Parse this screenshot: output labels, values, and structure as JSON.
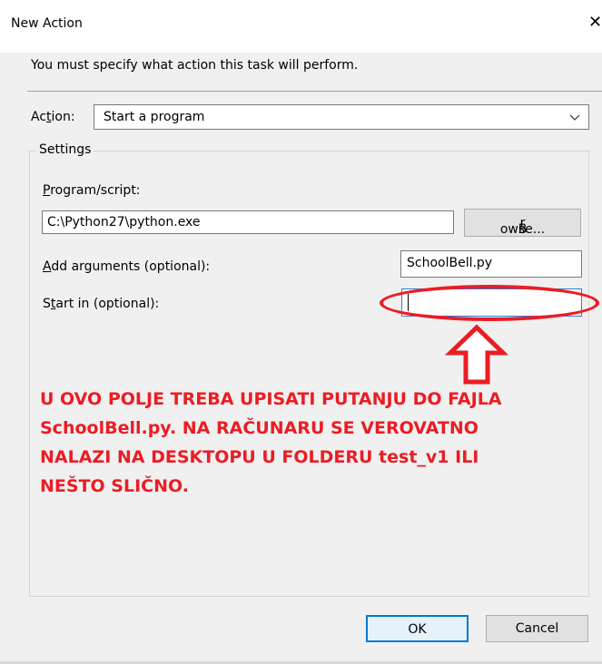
{
  "window": {
    "title": "New Action",
    "close_glyph": "✕"
  },
  "instruction": "You must specify what action this task will perform.",
  "action": {
    "label_pre": "Ac",
    "label_accel": "t",
    "label_post": "ion:",
    "value": "Start a program"
  },
  "settings": {
    "title": "Settings",
    "program": {
      "label_accel": "P",
      "label_post": "rogram/script:",
      "value": "C:\\Python27\\python.exe"
    },
    "browse": {
      "pre": "B",
      "accel": "r",
      "post": "owse..."
    },
    "arguments": {
      "label_accel": "A",
      "label_post": "dd arguments (optional):",
      "value": "SchoolBell.py"
    },
    "start_in": {
      "label_pre": "S",
      "label_accel": "t",
      "label_post": "art in (optional):",
      "value": ""
    }
  },
  "annotation": {
    "lines": [
      "U OVO POLJE TREBA UPISATI PUTANJU DO FAJLA",
      "SchoolBell.py. NA RAČUNARU SE VEROVATNO",
      "NALAZI NA DESKTOPU U FOLDERU test_v1 ILI",
      "NEŠTO SLIČNO."
    ],
    "color": "#ec1c24"
  },
  "buttons": {
    "ok": "OK",
    "cancel": "Cancel"
  },
  "icons": {
    "dropdown": "chevron-down-icon",
    "close": "close-icon",
    "arrow": "up-arrow-icon"
  }
}
